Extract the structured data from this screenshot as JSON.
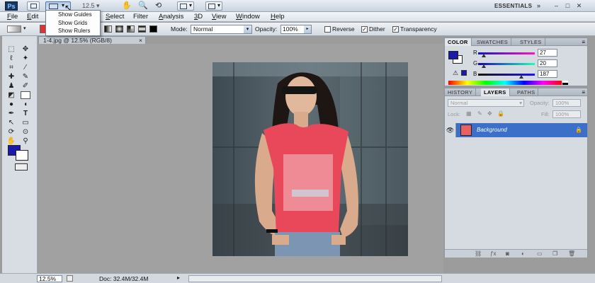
{
  "appbar": {
    "logo": "Ps",
    "zoom": "12.5",
    "workspace": "ESSENTIALS",
    "minimize": "–",
    "restore": "□",
    "close": "✕"
  },
  "menu": {
    "items": [
      {
        "label": "File",
        "u": "F",
        "rest": "ile"
      },
      {
        "label": "Edit",
        "u": "E",
        "rest": "dit"
      },
      {
        "label": "Select",
        "u": "S",
        "rest": "elect"
      },
      {
        "label": "Filter",
        "u": "",
        "rest": "Filter"
      },
      {
        "label": "Analysis",
        "u": "A",
        "rest": "nalysis"
      },
      {
        "label": "3D",
        "u": "3",
        "rest": "D"
      },
      {
        "label": "View",
        "u": "V",
        "rest": "iew"
      },
      {
        "label": "Window",
        "u": "W",
        "rest": "indow"
      },
      {
        "label": "Help",
        "u": "H",
        "rest": "elp"
      }
    ]
  },
  "dropdown": {
    "items": [
      "Show Guides",
      "Show Grids",
      "Show Rulers"
    ]
  },
  "options": {
    "mode_label": "Mode:",
    "mode_value": "Normal",
    "opacity_label": "Opacity:",
    "opacity_value": "100%",
    "reverse_label": "Reverse",
    "reverse_checked": false,
    "dither_label": "Dither",
    "dither_checked": true,
    "transparency_label": "Transparency",
    "transparency_checked": true
  },
  "document": {
    "tab_title": "1-4.jpg @ 12.5% (RGB/8)",
    "tab_close": "×"
  },
  "statusbar": {
    "zoom": "12.5%",
    "doc_info": "Doc: 32.4M/32.4M"
  },
  "color_panel": {
    "tabs": [
      "COLOR",
      "SWATCHES",
      "STYLES"
    ],
    "active_tab": "COLOR",
    "r_label": "R",
    "g_label": "G",
    "b_label": "B",
    "r": "27",
    "g": "20",
    "b": "187",
    "fg_color": "#1b14bb"
  },
  "layers_panel": {
    "tabs": [
      "HISTORY",
      "LAYERS",
      "PATHS"
    ],
    "active_tab": "LAYERS",
    "blend_mode": "Normal",
    "opacity_label": "Opacity:",
    "opacity_value": "100%",
    "lock_label": "Lock:",
    "fill_label": "Fill:",
    "fill_value": "100%",
    "layer_name": "Background",
    "selection_color": "#3c6fc8"
  },
  "colors": {
    "canvas_bg": "#a1a1a1",
    "shirt": "#e8485a"
  }
}
